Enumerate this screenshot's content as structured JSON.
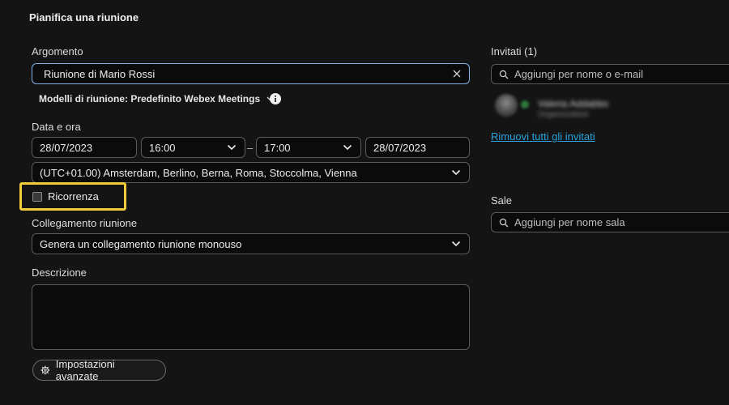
{
  "dialog": {
    "title": "Pianifica una riunione"
  },
  "topic": {
    "label": "Argomento",
    "value": "Riunione di Mario Rossi"
  },
  "templates": {
    "label": "Modelli di riunione: Predefinito Webex Meetings"
  },
  "datetime": {
    "label": "Data e ora",
    "start_date": "28/07/2023",
    "start_time": "16:00",
    "separator": "–",
    "end_time": "17:00",
    "end_date": "28/07/2023",
    "timezone": "(UTC+01.00) Amsterdam, Berlino, Berna, Roma, Stoccolma, Vienna"
  },
  "recurrence": {
    "label": "Ricorrenza",
    "checked": false
  },
  "meeting_link": {
    "label": "Collegamento riunione",
    "value": "Genera un collegamento riunione monouso"
  },
  "description": {
    "label": "Descrizione",
    "value": ""
  },
  "advanced": {
    "label": "Impostazioni avanzate"
  },
  "invitees": {
    "label": "Invitati (1)",
    "search_placeholder": "Aggiungi per nome o e-mail",
    "items": [
      {
        "name": "Valeria Addabbo",
        "role": "Organizzatore"
      }
    ],
    "remove_all": "Rimuovi tutti gli invitati"
  },
  "rooms": {
    "label": "Sale",
    "search_placeholder": "Aggiungi per nome sala"
  },
  "colors": {
    "background": "#141414",
    "highlight": "#f1cc3a",
    "link": "#2aa3dc",
    "focus_border": "#7fb3e6"
  }
}
